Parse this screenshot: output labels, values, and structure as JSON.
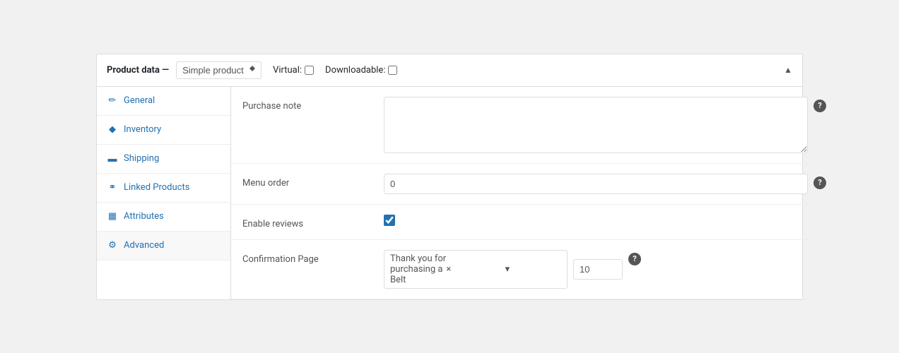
{
  "header": {
    "title": "Product data —",
    "product_type_label": "Simple product",
    "virtual_label": "Virtual:",
    "downloadable_label": "Downloadable:",
    "collapse_icon": "▲"
  },
  "sidebar": {
    "items": [
      {
        "id": "general",
        "label": "General",
        "icon": "wrench-icon"
      },
      {
        "id": "inventory",
        "label": "Inventory",
        "icon": "diamond-icon"
      },
      {
        "id": "shipping",
        "label": "Shipping",
        "icon": "truck-icon"
      },
      {
        "id": "linked-products",
        "label": "Linked Products",
        "icon": "link-icon"
      },
      {
        "id": "attributes",
        "label": "Attributes",
        "icon": "grid-icon"
      },
      {
        "id": "advanced",
        "label": "Advanced",
        "icon": "gear-icon"
      }
    ]
  },
  "fields": {
    "purchase_note": {
      "label": "Purchase note",
      "value": "",
      "placeholder": ""
    },
    "menu_order": {
      "label": "Menu order",
      "value": "0"
    },
    "enable_reviews": {
      "label": "Enable reviews",
      "checked": true
    },
    "confirmation_page": {
      "label": "Confirmation Page",
      "selected_value": "Thank you for purchasing a Belt",
      "order_value": "10"
    }
  },
  "icons": {
    "help": "?",
    "collapse": "▲",
    "x": "×",
    "arrow_down": "▾"
  }
}
